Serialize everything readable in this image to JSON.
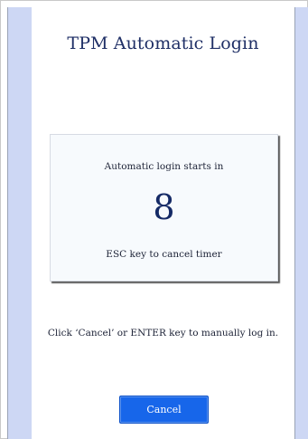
{
  "window": {
    "title": "TPM Automatic Login"
  },
  "countdown": {
    "label": "Automatic login starts in",
    "seconds_remaining": "8",
    "cancel_hint": "ESC key to cancel timer"
  },
  "instructions": {
    "manual_login_hint": "Click ‘Cancel’ or ENTER key to manually log in."
  },
  "actions": {
    "cancel_label": "Cancel"
  },
  "colors": {
    "accent": "#1766ea",
    "side_rail": "#cdd7f4",
    "title_text": "#1f2f66"
  }
}
